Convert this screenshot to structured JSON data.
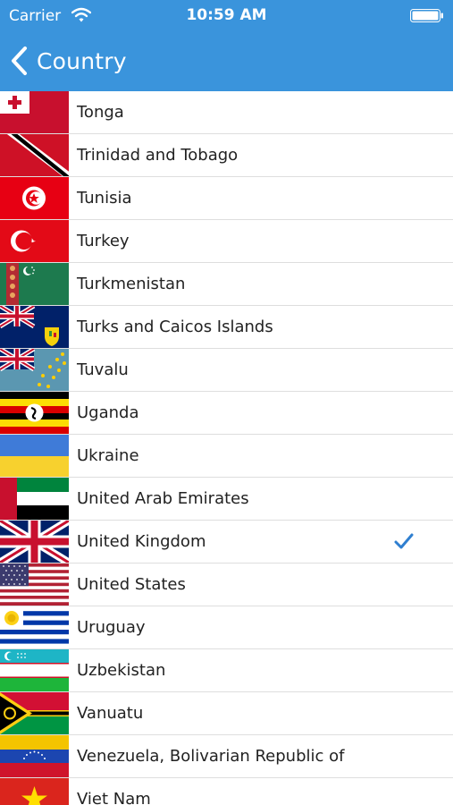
{
  "status_bar": {
    "carrier": "Carrier",
    "time": "10:59 AM",
    "wifi_icon": "wifi-icon",
    "battery_icon": "battery-icon"
  },
  "nav": {
    "back_label": "Country",
    "back_icon": "chevron-left-icon",
    "background": "#3a94dc"
  },
  "countries": [
    {
      "name": "Tonga",
      "selected": false,
      "flag_icon": "flag-tonga-icon"
    },
    {
      "name": "Trinidad and Tobago",
      "selected": false,
      "flag_icon": "flag-trinidad-and-tobago-icon"
    },
    {
      "name": "Tunisia",
      "selected": false,
      "flag_icon": "flag-tunisia-icon"
    },
    {
      "name": "Turkey",
      "selected": false,
      "flag_icon": "flag-turkey-icon"
    },
    {
      "name": "Turkmenistan",
      "selected": false,
      "flag_icon": "flag-turkmenistan-icon"
    },
    {
      "name": "Turks and Caicos Islands",
      "selected": false,
      "flag_icon": "flag-turks-and-caicos-icon"
    },
    {
      "name": "Tuvalu",
      "selected": false,
      "flag_icon": "flag-tuvalu-icon"
    },
    {
      "name": "Uganda",
      "selected": false,
      "flag_icon": "flag-uganda-icon"
    },
    {
      "name": "Ukraine",
      "selected": false,
      "flag_icon": "flag-ukraine-icon"
    },
    {
      "name": "United Arab Emirates",
      "selected": false,
      "flag_icon": "flag-uae-icon"
    },
    {
      "name": "United Kingdom",
      "selected": true,
      "flag_icon": "flag-united-kingdom-icon"
    },
    {
      "name": "United States",
      "selected": false,
      "flag_icon": "flag-united-states-icon"
    },
    {
      "name": "Uruguay",
      "selected": false,
      "flag_icon": "flag-uruguay-icon"
    },
    {
      "name": "Uzbekistan",
      "selected": false,
      "flag_icon": "flag-uzbekistan-icon"
    },
    {
      "name": "Vanuatu",
      "selected": false,
      "flag_icon": "flag-vanuatu-icon"
    },
    {
      "name": "Venezuela, Bolivarian Republic of",
      "selected": false,
      "flag_icon": "flag-venezuela-icon"
    },
    {
      "name": "Viet Nam",
      "selected": false,
      "flag_icon": "flag-viet-nam-icon"
    }
  ],
  "check_icon": "checkmark-icon",
  "check_color": "#2f7fd0"
}
